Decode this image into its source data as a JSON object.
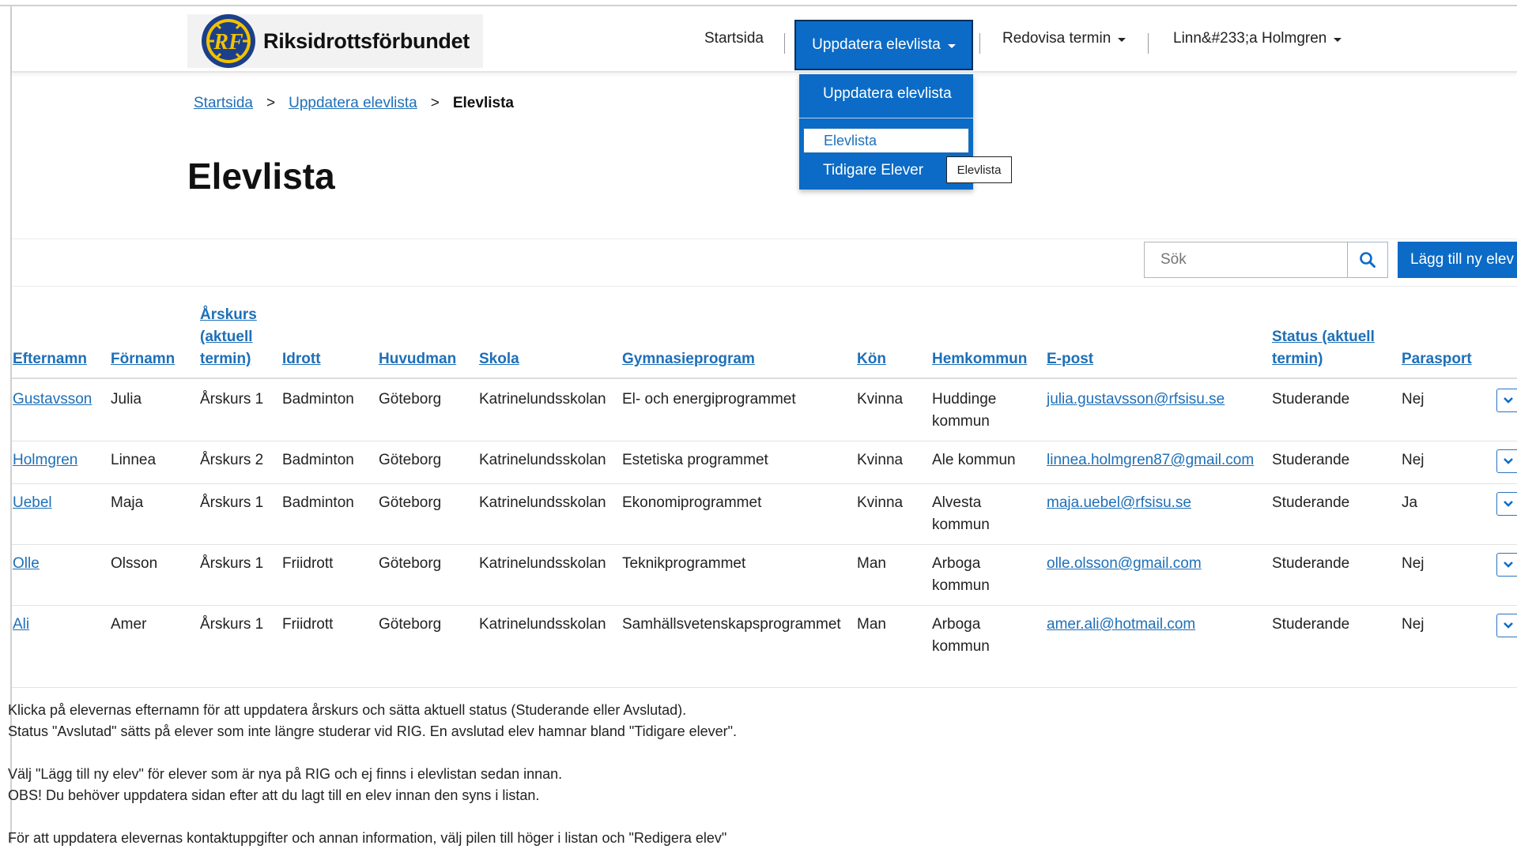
{
  "header": {
    "logo_text": "Riksidrottsförbundet",
    "nav": [
      {
        "label": "Startsida"
      },
      {
        "label": "Uppdatera elevlista"
      },
      {
        "label": "Redovisa termin"
      },
      {
        "label": "Linn&#233;a Holmgren"
      }
    ]
  },
  "dropdown": {
    "header": "Uppdatera elevlista",
    "items": [
      "Elevlista",
      "Tidigare Elever"
    ],
    "tooltip": "Elevlista"
  },
  "breadcrumb": {
    "items": [
      "Startsida",
      "Uppdatera elevlista"
    ],
    "separator": ">",
    "current": "Elevlista"
  },
  "page": {
    "title": "Elevlista"
  },
  "search": {
    "placeholder": "Sök"
  },
  "buttons": {
    "add": "Lägg till ny elev"
  },
  "table": {
    "columns": [
      {
        "line1": "Efternamn"
      },
      {
        "line1": "Förnamn"
      },
      {
        "line1": "Årskurs",
        "line2": "(aktuell",
        "line3": "termin)"
      },
      {
        "line1": "Idrott"
      },
      {
        "line1": "Huvudman"
      },
      {
        "line1": "Skola"
      },
      {
        "line1": "Gymnasieprogram"
      },
      {
        "line1": "Kön"
      },
      {
        "line1": "Hemkommun"
      },
      {
        "line1": "E-post"
      },
      {
        "line1": "Status (aktuell",
        "line2": "termin)"
      },
      {
        "line1": "Parasport"
      }
    ],
    "rows": [
      {
        "efternamn": "Gustavsson",
        "fornamn": "Julia",
        "arskurs": "Årskurs 1",
        "idrott": "Badminton",
        "huvudman": "Göteborg",
        "skola": "Katrinelundsskolan",
        "program": "El- och energiprogrammet",
        "kon": "Kvinna",
        "hemkommun1": "Huddinge",
        "hemkommun2": "kommun",
        "epost": "julia.gustavsson@rfsisu.se",
        "status": "Studerande",
        "parasport": "Nej"
      },
      {
        "efternamn": "Holmgren",
        "fornamn": "Linnea",
        "arskurs": "Årskurs 2",
        "idrott": "Badminton",
        "huvudman": "Göteborg",
        "skola": "Katrinelundsskolan",
        "program": "Estetiska programmet",
        "kon": "Kvinna",
        "hemkommun1": "Ale kommun",
        "hemkommun2": "",
        "epost": "linnea.holmgren87@gmail.com",
        "status": "Studerande",
        "parasport": "Nej"
      },
      {
        "efternamn": "Uebel",
        "fornamn": "Maja",
        "arskurs": "Årskurs 1",
        "idrott": "Badminton",
        "huvudman": "Göteborg",
        "skola": "Katrinelundsskolan",
        "program": "Ekonomiprogrammet",
        "kon": "Kvinna",
        "hemkommun1": "Alvesta",
        "hemkommun2": "kommun",
        "epost": "maja.uebel@rfsisu.se",
        "status": "Studerande",
        "parasport": "Ja"
      },
      {
        "efternamn": "Olle",
        "fornamn": "Olsson",
        "arskurs": "Årskurs 1",
        "idrott": "Friidrott",
        "huvudman": "Göteborg",
        "skola": "Katrinelundsskolan",
        "program": "Teknikprogrammet",
        "kon": "Man",
        "hemkommun1": "Arboga",
        "hemkommun2": "kommun",
        "epost": "olle.olsson@gmail.com",
        "status": "Studerande",
        "parasport": "Nej"
      },
      {
        "efternamn": "Ali",
        "fornamn": "Amer",
        "arskurs": "Årskurs 1",
        "idrott": "Friidrott",
        "huvudman": "Göteborg",
        "skola": "Katrinelundsskolan",
        "program": "Samhällsvetenskapsprogrammet",
        "kon": "Man",
        "hemkommun1": "Arboga",
        "hemkommun2": "kommun",
        "epost": "amer.ali@hotmail.com",
        "status": "Studerande",
        "parasport": "Nej"
      }
    ]
  },
  "info": [
    "Klicka på elevernas efternamn för att uppdatera årskurs och sätta aktuell status (Studerande eller Avslutad).",
    "Status \"Avslutad\" sätts på elever som inte längre studerar vid RIG. En avslutad elev hamnar bland \"Tidigare elever\".",
    "Välj \"Lägg till ny elev\" för elever som är nya på RIG och ej finns i elevlistan sedan innan.",
    "OBS! Du behöver uppdatera sidan efter att du lagt till en elev innan den syns i listan.",
    "För att uppdatera elevernas kontaktuppgifter och annan information, välj pilen till höger i listan och \"Redigera elev\""
  ],
  "colors": {
    "primary": "#0b6bc6",
    "link": "#1e6fb8",
    "emblem_gold": "#f2c200",
    "emblem_blue": "#1c3f8a"
  },
  "icons": [
    "rf-emblem-logo",
    "caret-down-icon",
    "search-icon",
    "chevron-down-icon"
  ]
}
